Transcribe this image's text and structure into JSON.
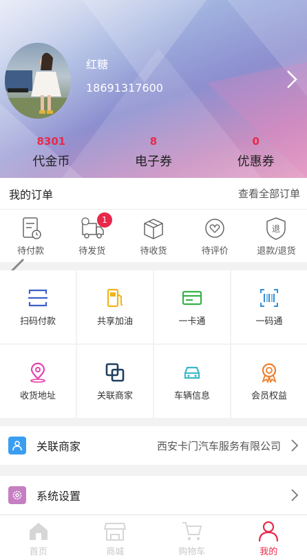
{
  "profile": {
    "username": "红糖",
    "phone": "18691317600"
  },
  "assets": [
    {
      "value": "8301",
      "label": "代金币"
    },
    {
      "value": "8",
      "label": "电子券"
    },
    {
      "value": "0",
      "label": "优惠券"
    }
  ],
  "orders": {
    "title": "我的订单",
    "view_all": "查看全部订单",
    "items": [
      {
        "label": "待付款",
        "icon": "pending-payment-icon"
      },
      {
        "label": "待发货",
        "icon": "pending-shipment-icon",
        "badge": "1"
      },
      {
        "label": "待收货",
        "icon": "pending-receipt-icon"
      },
      {
        "label": "待评价",
        "icon": "pending-review-icon"
      },
      {
        "label": "退款/退货",
        "icon": "refund-icon"
      }
    ]
  },
  "services": [
    {
      "label": "扫码付款",
      "icon": "scan-pay-icon",
      "color": "#3d5ec9"
    },
    {
      "label": "共享加油",
      "icon": "fuel-pump-icon",
      "color": "#f2b316"
    },
    {
      "label": "一卡通",
      "icon": "card-icon",
      "color": "#34b24a"
    },
    {
      "label": "一码通",
      "icon": "barcode-icon",
      "color": "#2f8fd8"
    },
    {
      "label": "收货地址",
      "icon": "location-pin-icon",
      "color": "#e83fae"
    },
    {
      "label": "关联商家",
      "icon": "link-merchant-icon",
      "color": "#1e3e5f"
    },
    {
      "label": "车辆信息",
      "icon": "car-icon",
      "color": "#3bb8c6"
    },
    {
      "label": "会员权益",
      "icon": "member-badge-icon",
      "color": "#ee7e2a"
    }
  ],
  "rows": {
    "merchant": {
      "label": "关联商家",
      "value": "西安卡门汽车服务有限公司",
      "icon": "user-icon",
      "color": "#3a9ef0"
    },
    "settings": {
      "label": "系统设置",
      "icon": "gear-icon",
      "color": "#c67fc2"
    }
  },
  "tabs": [
    {
      "label": "首页",
      "icon": "home-icon"
    },
    {
      "label": "商城",
      "icon": "store-icon"
    },
    {
      "label": "购物车",
      "icon": "cart-icon"
    },
    {
      "label": "我的",
      "icon": "profile-icon",
      "active": true
    }
  ],
  "colors": {
    "accent": "#e8294a"
  }
}
